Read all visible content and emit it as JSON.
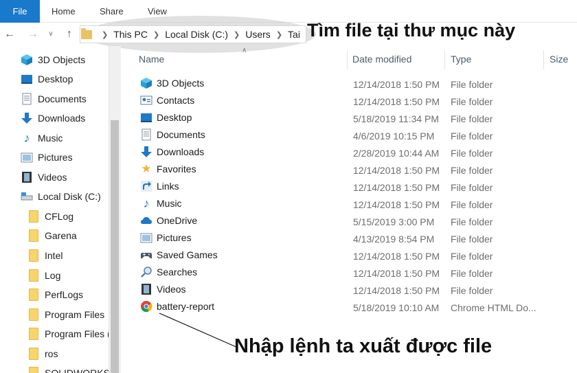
{
  "ribbon": {
    "tabs": [
      "File",
      "Home",
      "Share",
      "View"
    ]
  },
  "address": {
    "segments": [
      "This PC",
      "Local Disk (C:)",
      "Users",
      "Tai"
    ]
  },
  "annotations": {
    "top": "Tìm file tại thư mục này",
    "bottom": "Nhập lệnh ta xuất được file"
  },
  "sidebar": {
    "items": [
      {
        "label": "3D Objects",
        "icon": "3d-objects-icon"
      },
      {
        "label": "Desktop",
        "icon": "desktop-icon"
      },
      {
        "label": "Documents",
        "icon": "documents-icon"
      },
      {
        "label": "Downloads",
        "icon": "downloads-icon"
      },
      {
        "label": "Music",
        "icon": "music-icon"
      },
      {
        "label": "Pictures",
        "icon": "pictures-icon"
      },
      {
        "label": "Videos",
        "icon": "videos-icon"
      },
      {
        "label": "Local Disk (C:)",
        "icon": "drive-icon"
      },
      {
        "label": "CFLog",
        "icon": "folder-icon"
      },
      {
        "label": "Garena",
        "icon": "folder-icon"
      },
      {
        "label": "Intel",
        "icon": "folder-icon"
      },
      {
        "label": "Log",
        "icon": "folder-icon"
      },
      {
        "label": "PerfLogs",
        "icon": "folder-icon"
      },
      {
        "label": "Program Files",
        "icon": "folder-icon"
      },
      {
        "label": "Program Files (",
        "icon": "folder-icon"
      },
      {
        "label": "ros",
        "icon": "folder-icon"
      },
      {
        "label": "SOLIDWORKS D",
        "icon": "folder-icon"
      }
    ]
  },
  "columns": {
    "name": "Name",
    "date": "Date modified",
    "type": "Type",
    "size": "Size"
  },
  "files": [
    {
      "name": "3D Objects",
      "date": "12/14/2018 1:50 PM",
      "type": "File folder",
      "icon": "3d-objects-icon"
    },
    {
      "name": "Contacts",
      "date": "12/14/2018 1:50 PM",
      "type": "File folder",
      "icon": "contacts-icon"
    },
    {
      "name": "Desktop",
      "date": "5/18/2019 11:34 PM",
      "type": "File folder",
      "icon": "desktop-icon"
    },
    {
      "name": "Documents",
      "date": "4/6/2019 10:15 PM",
      "type": "File folder",
      "icon": "documents-icon"
    },
    {
      "name": "Downloads",
      "date": "2/28/2019 10:44 AM",
      "type": "File folder",
      "icon": "downloads-icon"
    },
    {
      "name": "Favorites",
      "date": "12/14/2018 1:50 PM",
      "type": "File folder",
      "icon": "favorites-icon"
    },
    {
      "name": "Links",
      "date": "12/14/2018 1:50 PM",
      "type": "File folder",
      "icon": "links-icon"
    },
    {
      "name": "Music",
      "date": "12/14/2018 1:50 PM",
      "type": "File folder",
      "icon": "music-icon"
    },
    {
      "name": "OneDrive",
      "date": "5/15/2019 3:00 PM",
      "type": "File folder",
      "icon": "onedrive-icon"
    },
    {
      "name": "Pictures",
      "date": "4/13/2019 8:54 PM",
      "type": "File folder",
      "icon": "pictures-icon"
    },
    {
      "name": "Saved Games",
      "date": "12/14/2018 1:50 PM",
      "type": "File folder",
      "icon": "saved-games-icon"
    },
    {
      "name": "Searches",
      "date": "12/14/2018 1:50 PM",
      "type": "File folder",
      "icon": "searches-icon"
    },
    {
      "name": "Videos",
      "date": "12/14/2018 1:50 PM",
      "type": "File folder",
      "icon": "videos-icon"
    },
    {
      "name": "battery-report",
      "date": "5/18/2019 10:10 AM",
      "type": "Chrome HTML Do...",
      "icon": "chrome-icon"
    }
  ]
}
